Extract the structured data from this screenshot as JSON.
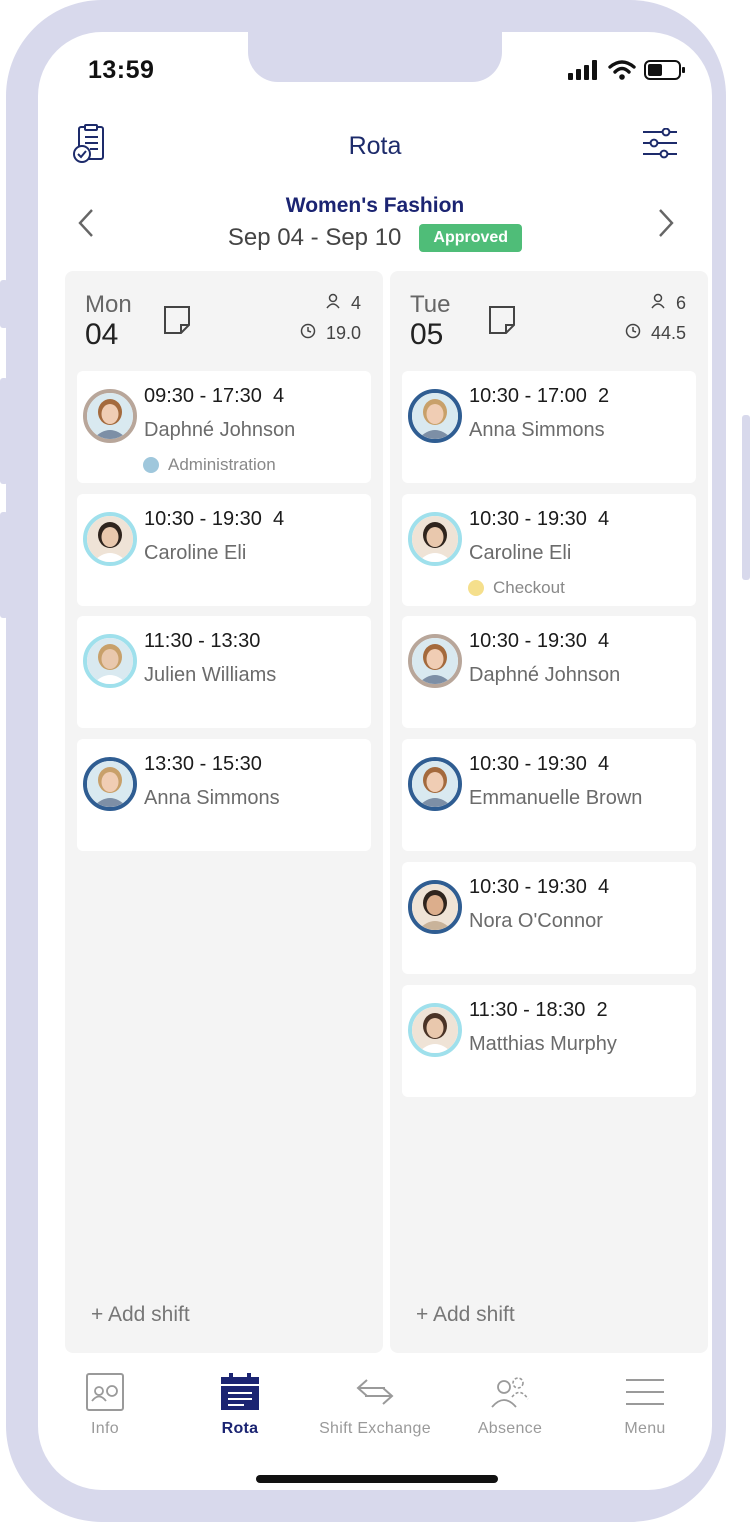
{
  "status": {
    "time": "13:59",
    "icons": [
      "signal-icon",
      "wifi-icon",
      "battery-icon"
    ]
  },
  "header": {
    "title": "Rota",
    "left_icon": "report-clipboard-icon",
    "right_icon": "filter-sliders-icon"
  },
  "week": {
    "org": "Women's Fashion",
    "range": "Sep 04 - Sep 10",
    "status": "Approved",
    "status_color": "#4fbd78"
  },
  "columns": [
    {
      "day": "Mon",
      "date": "04",
      "people": "4",
      "hours": "19.0",
      "add_label": "+ Add shift",
      "shifts": [
        {
          "time": "09:30 - 17:30",
          "breaks": "4",
          "name": "Daphné Johnson",
          "dept": "Administration",
          "dept_color": "#9fc7dc"
        },
        {
          "time": "10:30 - 19:30",
          "breaks": "4",
          "name": "Caroline Eli",
          "dept": "",
          "dept_color": ""
        },
        {
          "time": "11:30 - 13:30",
          "breaks": "",
          "name": "Julien Williams",
          "dept": "",
          "dept_color": ""
        },
        {
          "time": "13:30 - 15:30",
          "breaks": "",
          "name": "Anna Simmons",
          "dept": "",
          "dept_color": ""
        }
      ]
    },
    {
      "day": "Tue",
      "date": "05",
      "people": "6",
      "hours": "44.5",
      "add_label": "+ Add shift",
      "shifts": [
        {
          "time": "10:30 - 17:00",
          "breaks": "2",
          "name": "Anna Simmons",
          "dept": "",
          "dept_color": ""
        },
        {
          "time": "10:30 - 19:30",
          "breaks": "4",
          "name": "Caroline Eli",
          "dept": "Checkout",
          "dept_color": "#f5df8c"
        },
        {
          "time": "10:30 - 19:30",
          "breaks": "4",
          "name": "Daphné Johnson",
          "dept": "",
          "dept_color": ""
        },
        {
          "time": "10:30 - 19:30",
          "breaks": "4",
          "name": "Emmanuelle Brown",
          "dept": "",
          "dept_color": ""
        },
        {
          "time": "10:30 - 19:30",
          "breaks": "4",
          "name": "Nora O'Connor",
          "dept": "",
          "dept_color": ""
        },
        {
          "time": "11:30 - 18:30",
          "breaks": "2",
          "name": "Matthias Murphy",
          "dept": "",
          "dept_color": ""
        }
      ]
    }
  ],
  "tabs": [
    {
      "label": "Info",
      "icon": "info-card-icon",
      "active": false
    },
    {
      "label": "Rota",
      "icon": "calendar-icon",
      "active": true
    },
    {
      "label": "Shift Exchange",
      "icon": "exchange-arrows-icon",
      "active": false
    },
    {
      "label": "Absence",
      "icon": "absence-people-icon",
      "active": false
    },
    {
      "label": "Menu",
      "icon": "menu-lines-icon",
      "active": false
    }
  ]
}
